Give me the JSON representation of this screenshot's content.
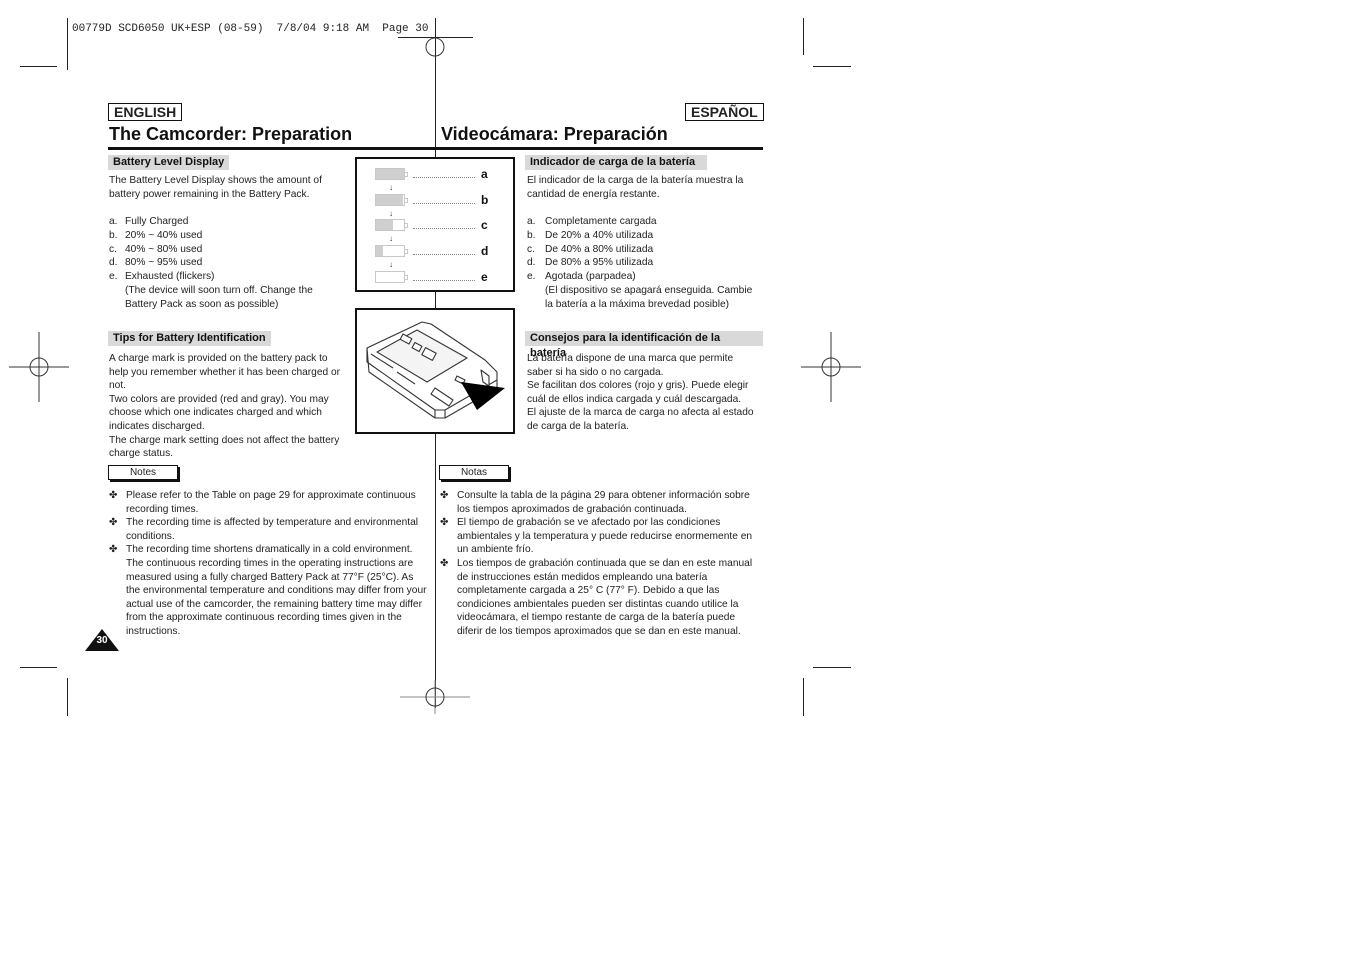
{
  "slug": "00779D SCD6050 UK+ESP (08-59)  7/8/04 9:18 AM  Page 30",
  "english": {
    "lang_label": "ENGLISH",
    "title": "The Camcorder: Preparation",
    "battery_level": {
      "heading": "Battery Level Display",
      "intro": [
        "The Battery Level Display shows the amount of",
        "battery power remaining in the Battery Pack."
      ],
      "items": [
        {
          "marker": "a.",
          "text": "Fully Charged"
        },
        {
          "marker": "b.",
          "text": "20% ~ 40% used"
        },
        {
          "marker": "c.",
          "text": "40% ~ 80% used"
        },
        {
          "marker": "d.",
          "text": "80% ~ 95% used"
        },
        {
          "marker": "e.",
          "text": "Exhausted (flickers)"
        },
        {
          "marker": "",
          "text": "(The device will soon turn off. Change the"
        },
        {
          "marker": "",
          "text": "Battery Pack as soon as possible)"
        }
      ]
    },
    "tips": {
      "heading": "Tips for Battery Identification",
      "lines": [
        "A charge mark is provided on the battery pack to",
        "help you remember whether it has been charged or",
        "not.",
        "Two colors are provided (red and gray). You may",
        "choose which one indicates charged and which",
        "indicates discharged.",
        "The charge mark setting does not affect the battery",
        "charge status."
      ]
    },
    "notes_label": "Notes",
    "notes": [
      {
        "bullet": "✤",
        "lines": [
          "Please refer to the Table on page 29 for approximate continuous",
          "recording times."
        ]
      },
      {
        "bullet": "✤",
        "lines": [
          "The recording time is affected by temperature and environmental",
          "conditions."
        ]
      },
      {
        "bullet": "✤",
        "lines": [
          "The recording time shortens dramatically in a cold environment.",
          "The continuous recording times in the operating instructions are",
          "measured using a fully charged Battery Pack at 77°F (25°C). As",
          "the environmental temperature and conditions may differ from your",
          "actual use of the camcorder, the remaining battery time may differ",
          "from the approximate continuous recording times given in the",
          "instructions."
        ]
      }
    ]
  },
  "spanish": {
    "lang_label": "ESPAÑOL",
    "title": "Videocámara: Preparación",
    "battery_level": {
      "heading": "Indicador de carga de la batería",
      "intro": [
        "El indicador de la carga de la batería muestra la",
        "cantidad de energía restante."
      ],
      "items": [
        {
          "marker": "a.",
          "text": "Completamente cargada"
        },
        {
          "marker": "b.",
          "text": "De 20% a 40% utilizada"
        },
        {
          "marker": "c.",
          "text": "De 40% a 80% utilizada"
        },
        {
          "marker": "d.",
          "text": "De 80% a 95% utilizada"
        },
        {
          "marker": "e.",
          "text": "Agotada (parpadea)"
        },
        {
          "marker": "",
          "text": "(El dispositivo se apagará enseguida. Cambie"
        },
        {
          "marker": "",
          "text": "la batería a la máxima brevedad posible)"
        }
      ]
    },
    "tips": {
      "heading": "Consejos para la identificación de la batería",
      "lines": [
        "La batería dispone de una marca que permite",
        "saber si ha sido o no cargada.",
        "Se facilitan dos colores (rojo y gris). Puede elegir",
        "cuál de ellos indica cargada y cuál descargada.",
        "El ajuste de la marca de carga no afecta al estado",
        "de carga de la batería."
      ]
    },
    "notes_label": "Notas",
    "notes": [
      {
        "bullet": "✤",
        "lines": [
          "Consulte la tabla de la página 29 para obtener información sobre",
          "los tiempos aproximados de grabación continuada."
        ]
      },
      {
        "bullet": "✤",
        "lines": [
          "El tiempo de grabación se ve afectado por las condiciones",
          "ambientales y la temperatura y puede reducirse enormemente en",
          "un ambiente frío."
        ]
      },
      {
        "bullet": "✤",
        "lines": [
          "Los tiempos de grabación continuada que se dan en este manual",
          "de instrucciones están medidos empleando una batería",
          "completamente cargada a 25° C (77° F). Debido a que las",
          "condiciones ambientales pueden ser distintas cuando utilice la",
          "videocámara, el tiempo restante de carga de la batería puede",
          "diferir de los tiempos aproximados que se dan en este manual."
        ]
      }
    ]
  },
  "battery_figure": {
    "levels": [
      {
        "label": "a",
        "charge_fraction": 1.0
      },
      {
        "label": "b",
        "charge_fraction": 0.95
      },
      {
        "label": "c",
        "charge_fraction": 0.6
      },
      {
        "label": "d",
        "charge_fraction": 0.25
      },
      {
        "label": "e",
        "charge_fraction": 0.0
      }
    ],
    "arrow_glyph": "↓"
  },
  "page_number": "30",
  "colors": {
    "subhead_bg": "#d9d9d9",
    "battery_fill": "#cfcfcf",
    "ink": "#111111"
  }
}
